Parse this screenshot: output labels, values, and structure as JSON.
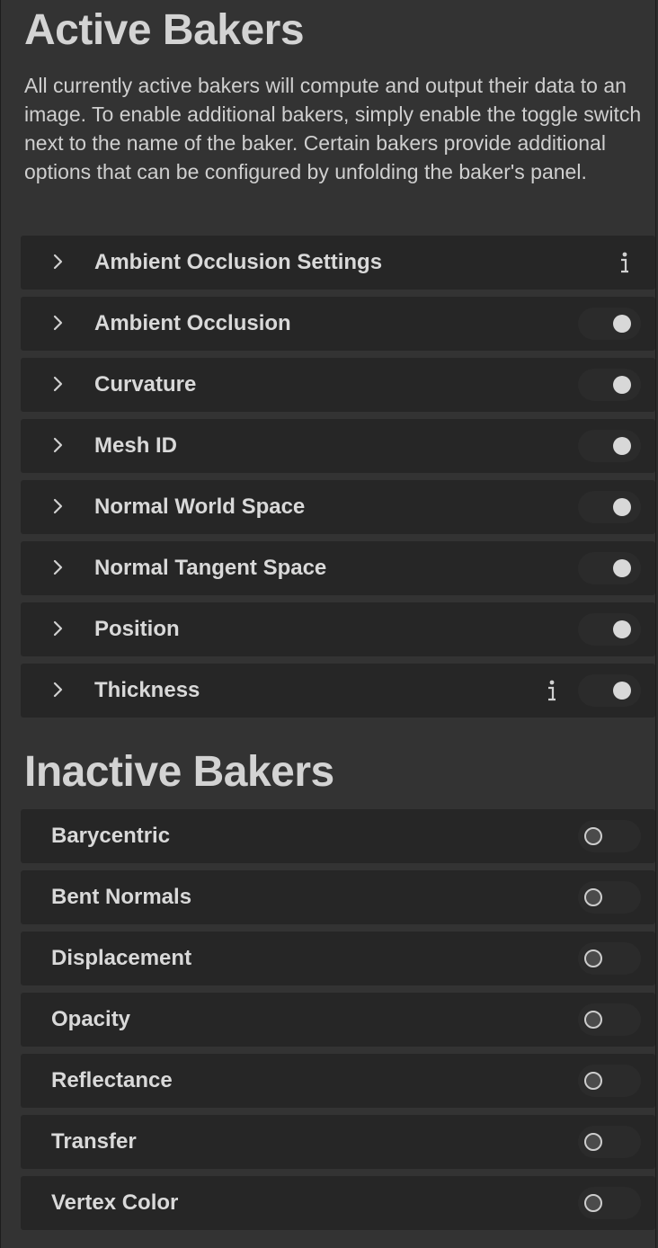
{
  "active": {
    "title": "Active Bakers",
    "description": "All currently active bakers will compute and output their data to an image. To enable additional bakers, simply enable the toggle switch next to the name of the baker. Certain bakers provide additional options that can be configured by unfolding the baker's panel.",
    "items": [
      {
        "label": "Ambient Occlusion Settings",
        "icon": "info-icon",
        "toggle": null
      },
      {
        "label": "Ambient Occlusion",
        "toggle": "on"
      },
      {
        "label": "Curvature",
        "toggle": "on"
      },
      {
        "label": "Mesh ID",
        "toggle": "on"
      },
      {
        "label": "Normal World Space",
        "toggle": "on"
      },
      {
        "label": "Normal Tangent Space",
        "toggle": "on"
      },
      {
        "label": "Position",
        "toggle": "on"
      },
      {
        "label": "Thickness",
        "icon": "info-icon",
        "toggle": "on"
      }
    ]
  },
  "inactive": {
    "title": "Inactive Bakers",
    "items": [
      {
        "label": "Barycentric",
        "toggle": "off"
      },
      {
        "label": "Bent Normals",
        "toggle": "off"
      },
      {
        "label": "Displacement",
        "toggle": "off"
      },
      {
        "label": "Opacity",
        "toggle": "off"
      },
      {
        "label": "Reflectance",
        "toggle": "off"
      },
      {
        "label": "Transfer",
        "toggle": "off"
      },
      {
        "label": "Vertex Color",
        "toggle": "off"
      }
    ]
  },
  "colors": {
    "background": "#333333",
    "row_background": "#262626",
    "text": "#d9d9d9",
    "toggle_track": "#2b2b2b",
    "knob_on": "#d8d8d8"
  }
}
